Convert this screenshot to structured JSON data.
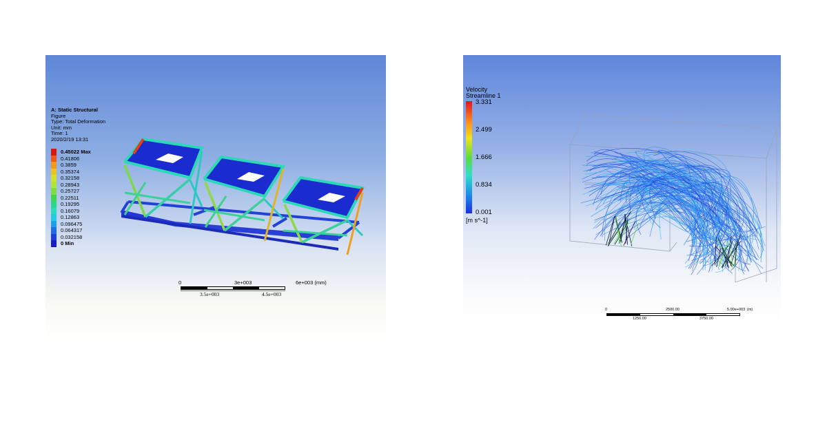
{
  "left_panel": {
    "title": "A: Static Structural",
    "info_lines": [
      "Figure",
      "Type: Total Deformation",
      "Unit: mm",
      "Time: 1",
      "2020/2/19 13:31"
    ],
    "legend": [
      {
        "label": "0.45022 Max",
        "color": "#d11a14",
        "bold": true
      },
      {
        "label": "0.41806",
        "color": "#ee5a1a",
        "bold": false
      },
      {
        "label": "0.3859",
        "color": "#f09a1f",
        "bold": false
      },
      {
        "label": "0.35374",
        "color": "#e8c429",
        "bold": false
      },
      {
        "label": "0.32158",
        "color": "#d3de2e",
        "bold": false
      },
      {
        "label": "0.28943",
        "color": "#b1e33a",
        "bold": false
      },
      {
        "label": "0.25727",
        "color": "#7fdc43",
        "bold": false
      },
      {
        "label": "0.22511",
        "color": "#44d452",
        "bold": false
      },
      {
        "label": "0.19295",
        "color": "#2dd58a",
        "bold": false
      },
      {
        "label": "0.16079",
        "color": "#2ed7bf",
        "bold": false
      },
      {
        "label": "0.12863",
        "color": "#26c9e0",
        "bold": false
      },
      {
        "label": "0.096475",
        "color": "#1f9ee8",
        "bold": false
      },
      {
        "label": "0.064317",
        "color": "#1f6ee3",
        "bold": false
      },
      {
        "label": "0.032158",
        "color": "#1e3fd6",
        "bold": false
      },
      {
        "label": "0 Min",
        "color": "#1a1bc4",
        "bold": true
      }
    ],
    "scale": {
      "top_labels": [
        "0",
        "3e+003",
        "6e+003 (mm)"
      ],
      "bottom_labels": [
        "3.5e+003",
        "4.5e+003"
      ]
    }
  },
  "right_panel": {
    "title_lines": [
      "Velocity",
      "Streamline 1"
    ],
    "legend_labels": [
      "3.331",
      "2.499",
      "1.666",
      "0.834",
      "0.001"
    ],
    "unit": "[m s^-1]",
    "scale": {
      "top_labels": [
        "0",
        "2500.00",
        "5.00e+003",
        "(m)"
      ],
      "bottom_labels": [
        "1250.00",
        "3750.00"
      ]
    }
  }
}
